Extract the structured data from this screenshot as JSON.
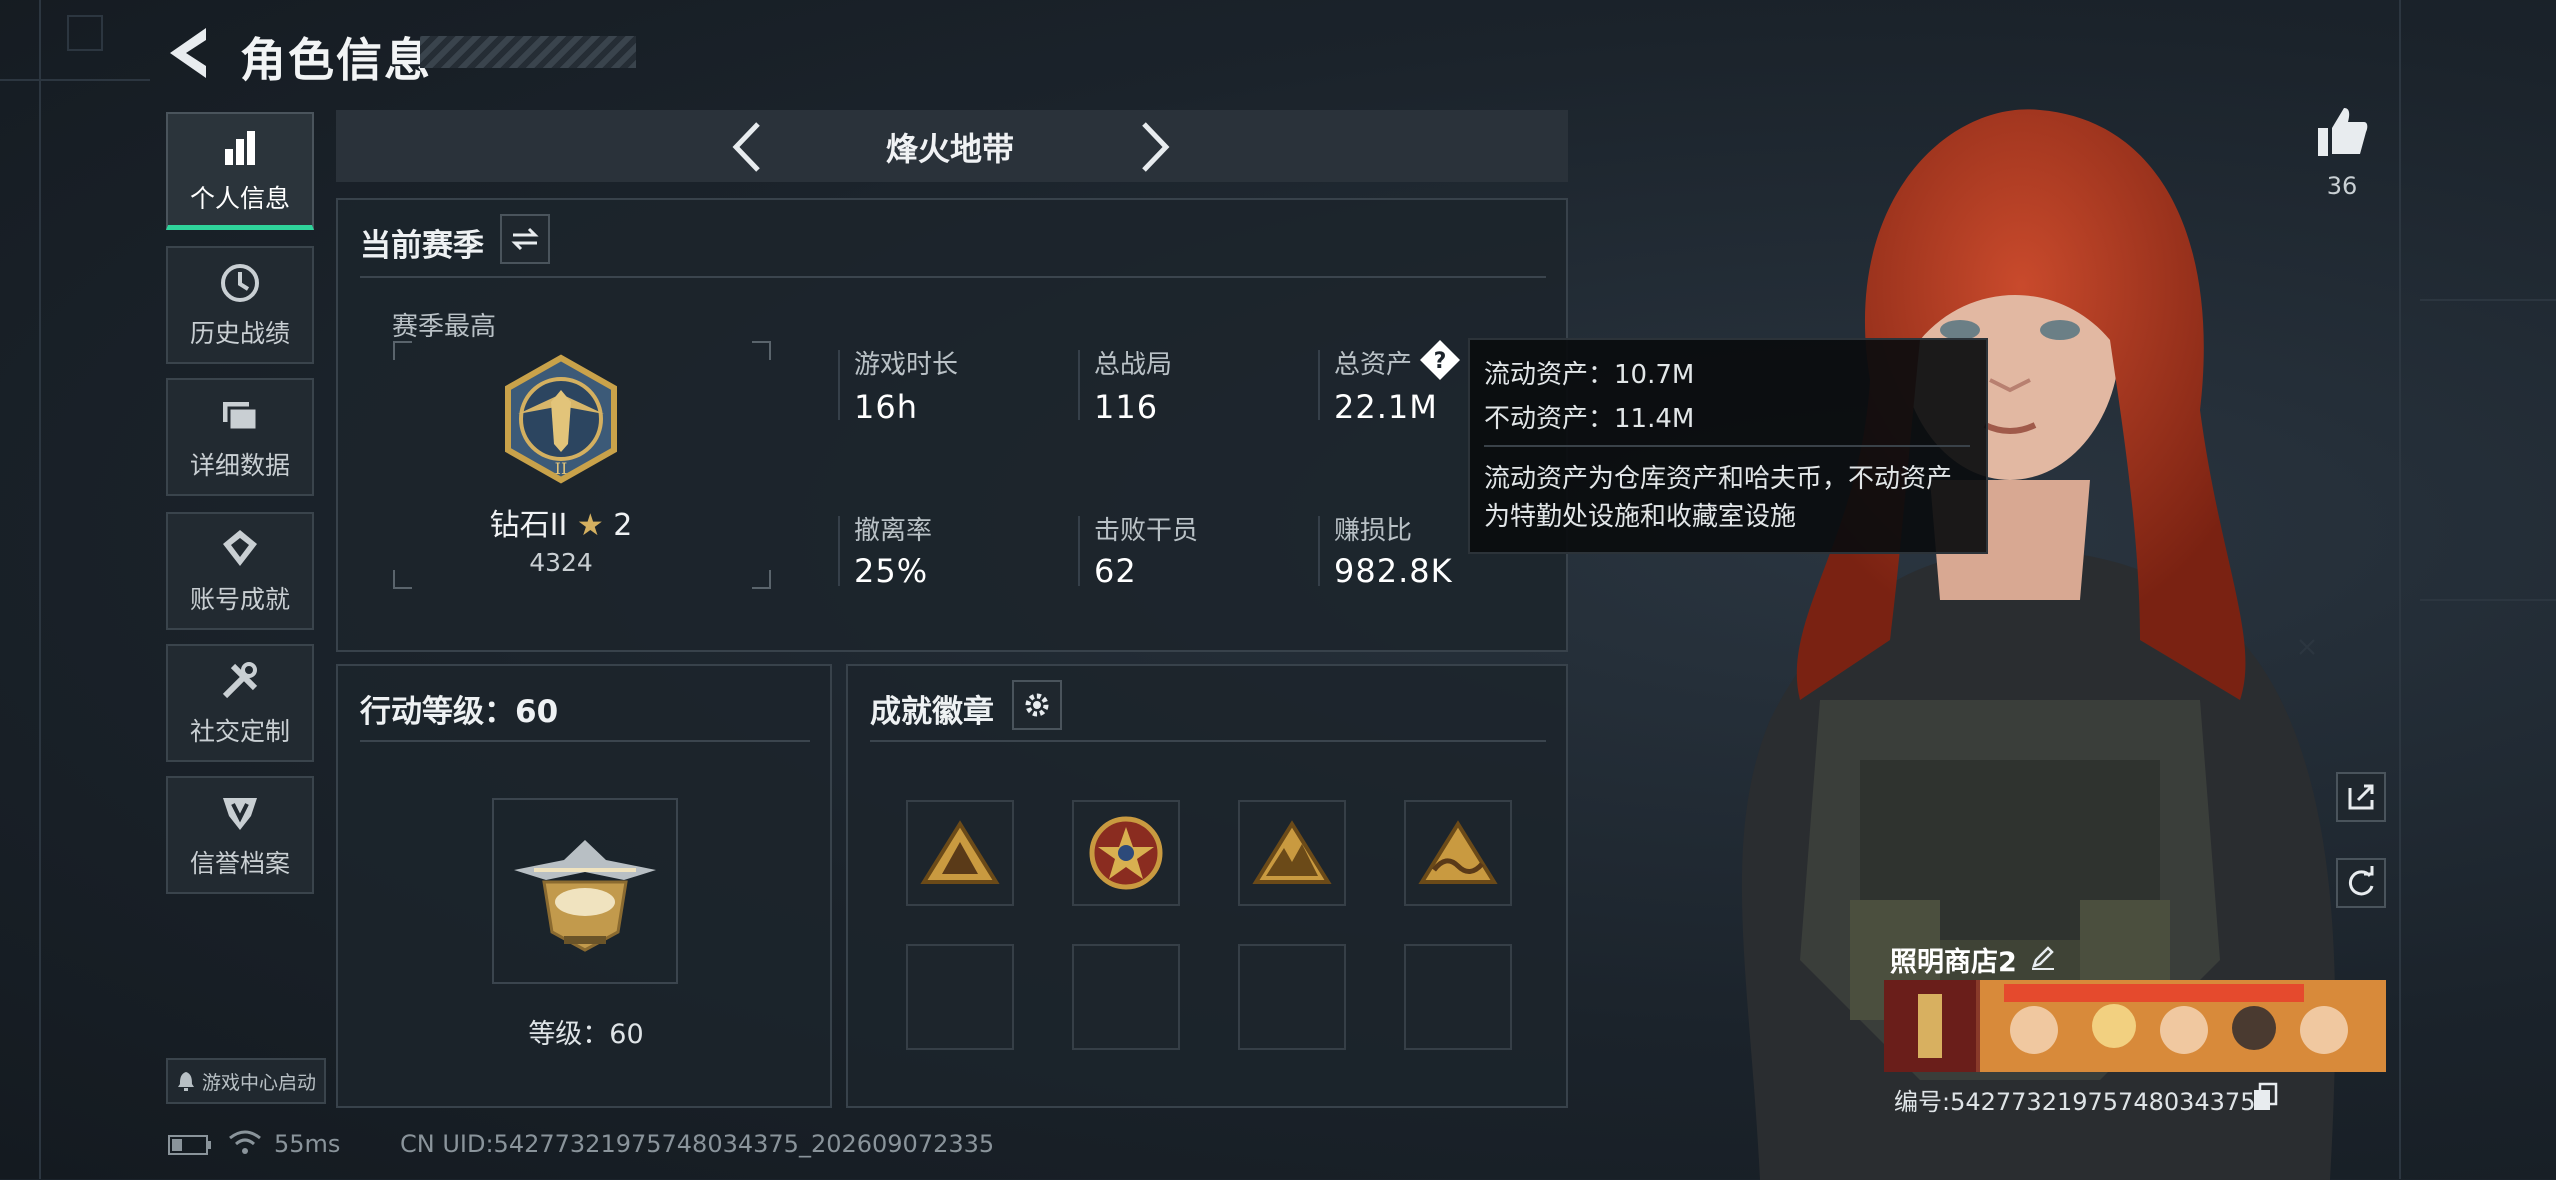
{
  "header": {
    "title": "角色信息"
  },
  "nav": {
    "items": [
      {
        "label": "个人信息",
        "icon": "bar-chart-icon",
        "active": true
      },
      {
        "label": "历史战绩",
        "icon": "clock-icon",
        "active": false
      },
      {
        "label": "详细数据",
        "icon": "folder-icon",
        "active": false
      },
      {
        "label": "账号成就",
        "icon": "trophy-icon",
        "active": false
      },
      {
        "label": "社交定制",
        "icon": "tools-icon",
        "active": false
      },
      {
        "label": "信誉档案",
        "icon": "credit-shield-icon",
        "active": false
      }
    ],
    "game_center": "游戏中心启动"
  },
  "mode": {
    "title": "烽火地带"
  },
  "season": {
    "title": "当前赛季",
    "best_label": "赛季最高",
    "rank_name": "钻石II",
    "rank_stars": "2",
    "rank_score": "4324",
    "stats": [
      {
        "label": "游戏时长",
        "value": "16h"
      },
      {
        "label": "总战局",
        "value": "116"
      },
      {
        "label": "总资产",
        "value": "22.1M"
      },
      {
        "label": "撤离率",
        "value": "25%"
      },
      {
        "label": "击败干员",
        "value": "62"
      },
      {
        "label": "赚损比",
        "value": "982.8K"
      }
    ]
  },
  "tooltip": {
    "liquid": "流动资产：10.7M",
    "fixed": "不动资产：11.4M",
    "desc_1": "流动资产为仓库资产和哈夫币，不动资产",
    "desc_2": "为特勤处设施和收藏室设施"
  },
  "level": {
    "title": "行动等级：60",
    "level_text": "等级：60"
  },
  "badges": {
    "title": "成就徽章",
    "filled": [
      "triangle-badge-icon",
      "star-seal-badge-icon",
      "mountain-badge-icon",
      "wave-badge-icon"
    ]
  },
  "profile": {
    "likes": "36",
    "shop_name": "照明商店2",
    "shop_id": "编号:5427732197574803437​5"
  },
  "status": {
    "ping": "55ms",
    "uid": "CN UID:54277321975748034375_202609072335"
  },
  "colors": {
    "accent": "#2fd49b",
    "panel_border": "#38424b",
    "gold": "#c9a24a"
  }
}
